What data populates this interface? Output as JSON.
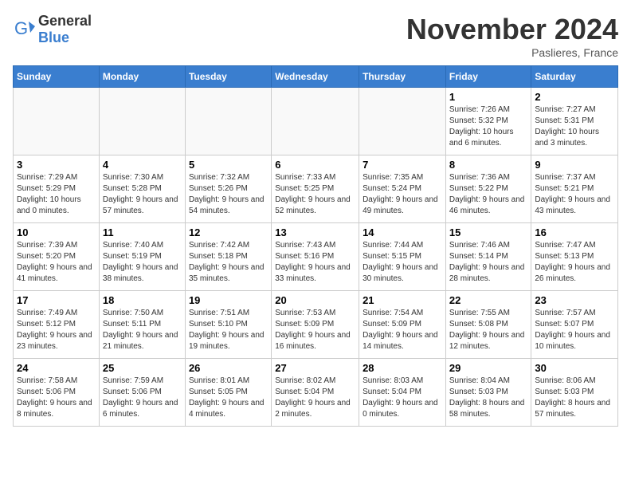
{
  "header": {
    "logo_general": "General",
    "logo_blue": "Blue",
    "month_title": "November 2024",
    "subtitle": "Paslieres, France"
  },
  "weekdays": [
    "Sunday",
    "Monday",
    "Tuesday",
    "Wednesday",
    "Thursday",
    "Friday",
    "Saturday"
  ],
  "weeks": [
    [
      {
        "day": "",
        "info": "",
        "empty": true
      },
      {
        "day": "",
        "info": "",
        "empty": true
      },
      {
        "day": "",
        "info": "",
        "empty": true
      },
      {
        "day": "",
        "info": "",
        "empty": true
      },
      {
        "day": "",
        "info": "",
        "empty": true
      },
      {
        "day": "1",
        "info": "Sunrise: 7:26 AM\nSunset: 5:32 PM\nDaylight: 10 hours and 6 minutes."
      },
      {
        "day": "2",
        "info": "Sunrise: 7:27 AM\nSunset: 5:31 PM\nDaylight: 10 hours and 3 minutes."
      }
    ],
    [
      {
        "day": "3",
        "info": "Sunrise: 7:29 AM\nSunset: 5:29 PM\nDaylight: 10 hours and 0 minutes."
      },
      {
        "day": "4",
        "info": "Sunrise: 7:30 AM\nSunset: 5:28 PM\nDaylight: 9 hours and 57 minutes."
      },
      {
        "day": "5",
        "info": "Sunrise: 7:32 AM\nSunset: 5:26 PM\nDaylight: 9 hours and 54 minutes."
      },
      {
        "day": "6",
        "info": "Sunrise: 7:33 AM\nSunset: 5:25 PM\nDaylight: 9 hours and 52 minutes."
      },
      {
        "day": "7",
        "info": "Sunrise: 7:35 AM\nSunset: 5:24 PM\nDaylight: 9 hours and 49 minutes."
      },
      {
        "day": "8",
        "info": "Sunrise: 7:36 AM\nSunset: 5:22 PM\nDaylight: 9 hours and 46 minutes."
      },
      {
        "day": "9",
        "info": "Sunrise: 7:37 AM\nSunset: 5:21 PM\nDaylight: 9 hours and 43 minutes."
      }
    ],
    [
      {
        "day": "10",
        "info": "Sunrise: 7:39 AM\nSunset: 5:20 PM\nDaylight: 9 hours and 41 minutes."
      },
      {
        "day": "11",
        "info": "Sunrise: 7:40 AM\nSunset: 5:19 PM\nDaylight: 9 hours and 38 minutes."
      },
      {
        "day": "12",
        "info": "Sunrise: 7:42 AM\nSunset: 5:18 PM\nDaylight: 9 hours and 35 minutes."
      },
      {
        "day": "13",
        "info": "Sunrise: 7:43 AM\nSunset: 5:16 PM\nDaylight: 9 hours and 33 minutes."
      },
      {
        "day": "14",
        "info": "Sunrise: 7:44 AM\nSunset: 5:15 PM\nDaylight: 9 hours and 30 minutes."
      },
      {
        "day": "15",
        "info": "Sunrise: 7:46 AM\nSunset: 5:14 PM\nDaylight: 9 hours and 28 minutes."
      },
      {
        "day": "16",
        "info": "Sunrise: 7:47 AM\nSunset: 5:13 PM\nDaylight: 9 hours and 26 minutes."
      }
    ],
    [
      {
        "day": "17",
        "info": "Sunrise: 7:49 AM\nSunset: 5:12 PM\nDaylight: 9 hours and 23 minutes."
      },
      {
        "day": "18",
        "info": "Sunrise: 7:50 AM\nSunset: 5:11 PM\nDaylight: 9 hours and 21 minutes."
      },
      {
        "day": "19",
        "info": "Sunrise: 7:51 AM\nSunset: 5:10 PM\nDaylight: 9 hours and 19 minutes."
      },
      {
        "day": "20",
        "info": "Sunrise: 7:53 AM\nSunset: 5:09 PM\nDaylight: 9 hours and 16 minutes."
      },
      {
        "day": "21",
        "info": "Sunrise: 7:54 AM\nSunset: 5:09 PM\nDaylight: 9 hours and 14 minutes."
      },
      {
        "day": "22",
        "info": "Sunrise: 7:55 AM\nSunset: 5:08 PM\nDaylight: 9 hours and 12 minutes."
      },
      {
        "day": "23",
        "info": "Sunrise: 7:57 AM\nSunset: 5:07 PM\nDaylight: 9 hours and 10 minutes."
      }
    ],
    [
      {
        "day": "24",
        "info": "Sunrise: 7:58 AM\nSunset: 5:06 PM\nDaylight: 9 hours and 8 minutes."
      },
      {
        "day": "25",
        "info": "Sunrise: 7:59 AM\nSunset: 5:06 PM\nDaylight: 9 hours and 6 minutes."
      },
      {
        "day": "26",
        "info": "Sunrise: 8:01 AM\nSunset: 5:05 PM\nDaylight: 9 hours and 4 minutes."
      },
      {
        "day": "27",
        "info": "Sunrise: 8:02 AM\nSunset: 5:04 PM\nDaylight: 9 hours and 2 minutes."
      },
      {
        "day": "28",
        "info": "Sunrise: 8:03 AM\nSunset: 5:04 PM\nDaylight: 9 hours and 0 minutes."
      },
      {
        "day": "29",
        "info": "Sunrise: 8:04 AM\nSunset: 5:03 PM\nDaylight: 8 hours and 58 minutes."
      },
      {
        "day": "30",
        "info": "Sunrise: 8:06 AM\nSunset: 5:03 PM\nDaylight: 8 hours and 57 minutes."
      }
    ]
  ]
}
